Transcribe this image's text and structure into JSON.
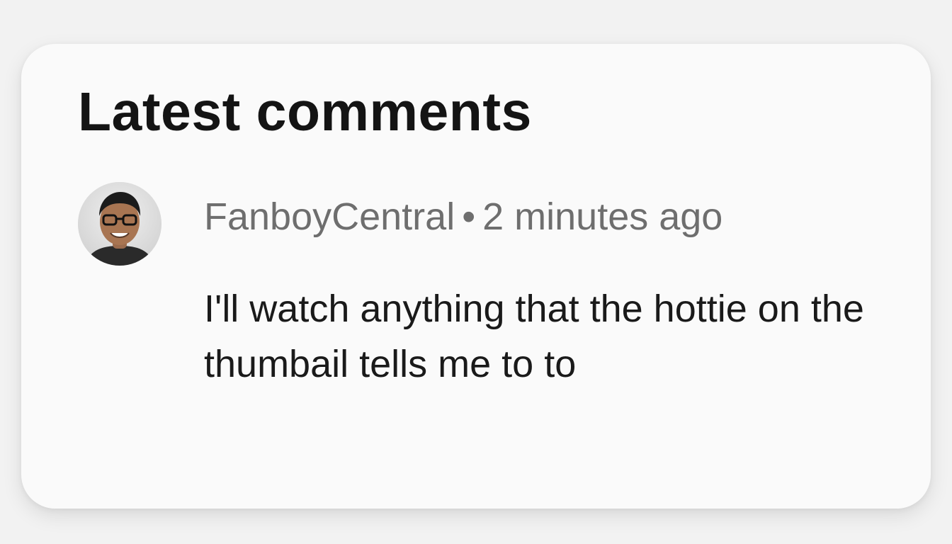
{
  "widget": {
    "title": "Latest comments"
  },
  "comment": {
    "author": "FanboyCentral",
    "separator": "•",
    "time": "2 minutes ago",
    "text": "I'll watch anything that the hottie on the thumbail tells me to to",
    "avatar_icon": "user-avatar-photo"
  }
}
